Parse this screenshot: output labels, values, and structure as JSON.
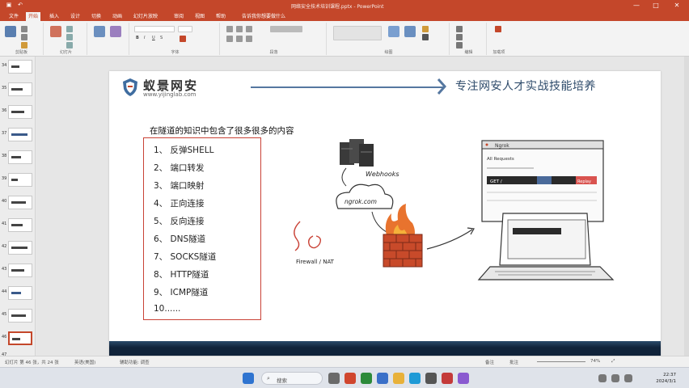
{
  "window": {
    "title": "网络安全技术培训课程.pptx - PowerPoint",
    "minimize": "—",
    "maximize": "□",
    "close": "✕"
  },
  "ribbon": {
    "tabs": [
      "文件",
      "开始",
      "插入",
      "设计",
      "切换",
      "动画",
      "幻灯片放映",
      "审阅",
      "视图",
      "帮助",
      "告诉我你想要做什么"
    ],
    "active_tab_index": 1,
    "groups": [
      "剪贴板",
      "幻灯片",
      "字体",
      "段落",
      "绘图",
      "编辑",
      "加载项"
    ]
  },
  "thumbnails": {
    "numbers": [
      "34",
      "35",
      "36",
      "37",
      "38",
      "39",
      "40",
      "41",
      "42",
      "43",
      "44",
      "45",
      "46",
      "47"
    ],
    "selected_index": 12
  },
  "slide": {
    "brand": "蚁景网安",
    "url": "www.yijinglab.com",
    "slogan": "专注网安人才实战技能培养",
    "subtitle": "在隧道的知识中包含了很多很多的内容",
    "items": [
      "1、 反弹SHELL",
      "2、 端口转发",
      "3、 端口映射",
      "4、 正向连接",
      "5、 反向连接",
      "6、 DNS隧道",
      "7、 SOCKS隧道",
      "8、 HTTP隧道",
      "9、 ICMP隧道",
      "10......"
    ],
    "diagram": {
      "webhooks_label": "Webhooks",
      "ngrok_label": "ngrok.com",
      "firewall_label": "Firewall / NAT",
      "browser_tab": "Ngrok",
      "browser_text_1": "All Requests",
      "browser_text_2": "GET /",
      "browser_button": "Replay"
    }
  },
  "statusbar": {
    "slide_info": "幻灯片 第 46 张，共 24 张",
    "language": "英语(美国)",
    "accessibility": "辅助功能: 调查",
    "notes": "备注",
    "comments": "批注",
    "zoom": "74%"
  },
  "taskbar": {
    "search_placeholder": "搜索",
    "time": "22:37",
    "date": "2024/3/1"
  },
  "colors": {
    "accent": "#c4472a",
    "list_border": "#c94236",
    "slogan": "#2d4a6a",
    "bottom_bar": "#10233a"
  }
}
